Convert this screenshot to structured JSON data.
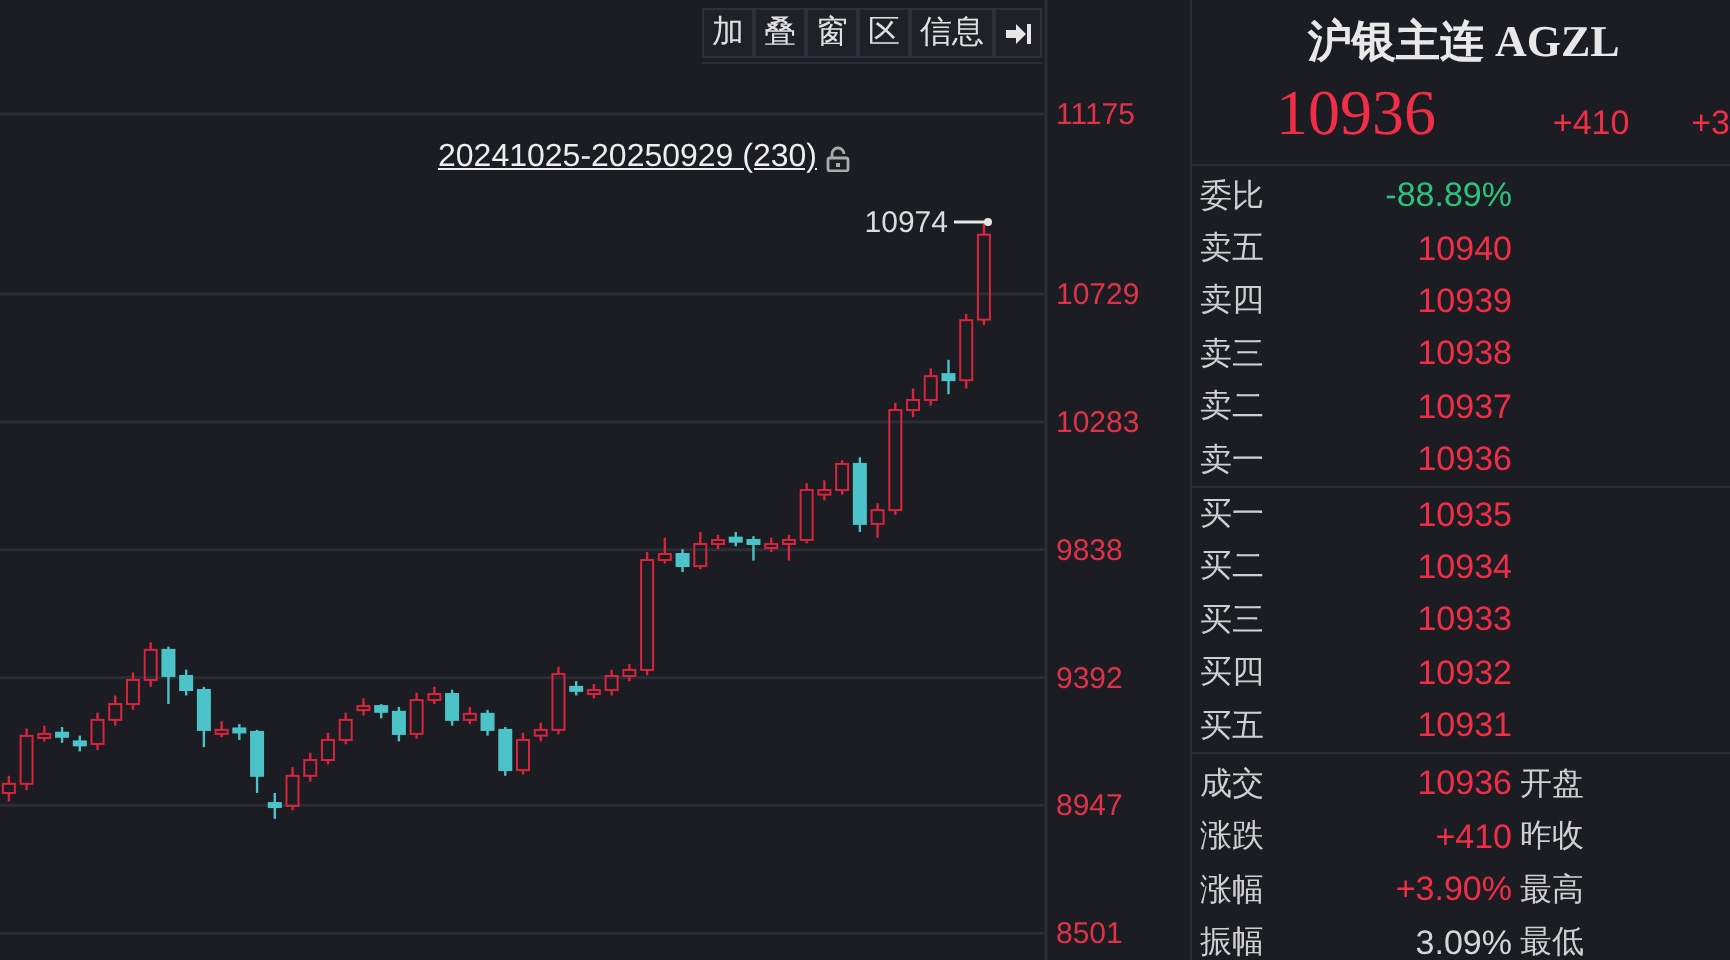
{
  "toolbar": {
    "buttons": [
      {
        "label": "加"
      },
      {
        "label": "叠"
      },
      {
        "label": "窗"
      },
      {
        "label": "区"
      },
      {
        "label": "信息"
      }
    ]
  },
  "chart": {
    "range_label": "20241025-20250929 (230)",
    "high_marker": "10974",
    "top_label": "11175",
    "chart_data": {
      "type": "candlestick",
      "ylim": [
        8408,
        11754
      ],
      "grid": true,
      "yticks": [
        10729,
        10283,
        9838,
        9392,
        8947,
        8501
      ],
      "ohlc": [
        [
          8990,
          9050,
          8960,
          9022
        ],
        [
          9022,
          9215,
          9000,
          9189
        ],
        [
          9189,
          9225,
          9170,
          9196
        ],
        [
          9200,
          9220,
          9165,
          9189
        ],
        [
          9170,
          9190,
          9135,
          9161
        ],
        [
          9161,
          9270,
          9140,
          9245
        ],
        [
          9245,
          9330,
          9225,
          9300
        ],
        [
          9300,
          9410,
          9280,
          9384
        ],
        [
          9384,
          9515,
          9360,
          9489
        ],
        [
          9489,
          9500,
          9300,
          9398
        ],
        [
          9398,
          9420,
          9330,
          9349
        ],
        [
          9349,
          9360,
          9150,
          9210
        ],
        [
          9205,
          9240,
          9185,
          9210
        ],
        [
          9215,
          9230,
          9175,
          9203
        ],
        [
          9203,
          9210,
          8990,
          9050
        ],
        [
          8955,
          8990,
          8900,
          8945
        ],
        [
          8945,
          9080,
          8930,
          9050
        ],
        [
          9050,
          9130,
          9030,
          9105
        ],
        [
          9105,
          9200,
          9090,
          9175
        ],
        [
          9175,
          9270,
          9160,
          9245
        ],
        [
          9280,
          9320,
          9260,
          9293
        ],
        [
          9293,
          9300,
          9250,
          9273
        ],
        [
          9273,
          9290,
          9170,
          9196
        ],
        [
          9196,
          9340,
          9180,
          9314
        ],
        [
          9314,
          9360,
          9300,
          9335
        ],
        [
          9335,
          9350,
          9225,
          9245
        ],
        [
          9245,
          9290,
          9230,
          9266
        ],
        [
          9266,
          9280,
          9190,
          9210
        ],
        [
          9210,
          9220,
          9050,
          9070
        ],
        [
          9070,
          9200,
          9055,
          9175
        ],
        [
          9190,
          9235,
          9170,
          9210
        ],
        [
          9210,
          9430,
          9195,
          9405
        ],
        [
          9360,
          9380,
          9330,
          9349
        ],
        [
          9340,
          9370,
          9320,
          9349
        ],
        [
          9349,
          9420,
          9330,
          9398
        ],
        [
          9398,
          9440,
          9380,
          9419
        ],
        [
          9419,
          9830,
          9400,
          9802
        ],
        [
          9802,
          9880,
          9790,
          9823
        ],
        [
          9823,
          9840,
          9760,
          9781
        ],
        [
          9781,
          9900,
          9770,
          9858
        ],
        [
          9860,
          9890,
          9840,
          9872
        ],
        [
          9880,
          9900,
          9850,
          9872
        ],
        [
          9872,
          9885,
          9800,
          9858
        ],
        [
          9850,
          9880,
          9830,
          9858
        ],
        [
          9858,
          9890,
          9800,
          9872
        ],
        [
          9872,
          10070,
          9860,
          10046
        ],
        [
          10030,
          10080,
          10010,
          10046
        ],
        [
          10046,
          10150,
          10030,
          10137
        ],
        [
          10137,
          10160,
          9900,
          9928
        ],
        [
          9928,
          10000,
          9880,
          9976
        ],
        [
          9976,
          10350,
          9960,
          10325
        ],
        [
          10325,
          10400,
          10300,
          10360
        ],
        [
          10360,
          10470,
          10340,
          10443
        ],
        [
          10450,
          10500,
          10380,
          10429
        ],
        [
          10429,
          10660,
          10400,
          10638
        ],
        [
          10640,
          10974,
          10620,
          10936
        ]
      ]
    }
  },
  "quote": {
    "title": "沪银主连 AGZL",
    "price": "10936",
    "change": "+410",
    "change_pct": "+3"
  },
  "order_book": [
    {
      "label": "委比",
      "value": "-88.89%",
      "color": "#2ec27e"
    },
    {
      "label": "卖五",
      "value": "10940",
      "color": "#f02e48"
    },
    {
      "label": "卖四",
      "value": "10939",
      "color": "#f02e48"
    },
    {
      "label": "卖三",
      "value": "10938",
      "color": "#f02e48"
    },
    {
      "label": "卖二",
      "value": "10937",
      "color": "#f02e48"
    },
    {
      "label": "卖一",
      "value": "10936",
      "color": "#f02e48"
    },
    {
      "label": "买一",
      "value": "10935",
      "color": "#f02e48"
    },
    {
      "label": "买二",
      "value": "10934",
      "color": "#f02e48"
    },
    {
      "label": "买三",
      "value": "10933",
      "color": "#f02e48"
    },
    {
      "label": "买四",
      "value": "10932",
      "color": "#f02e48"
    },
    {
      "label": "买五",
      "value": "10931",
      "color": "#f02e48"
    }
  ],
  "stats": [
    {
      "label": "成交",
      "value": "10936",
      "color": "#f02e48",
      "label_2": "开盘"
    },
    {
      "label": "涨跌",
      "value": "+410",
      "color": "#f02e48",
      "label_2": "昨收"
    },
    {
      "label": "涨幅",
      "value": "+3.90%",
      "color": "#f02e48",
      "label_2": "最高"
    },
    {
      "label": "振幅",
      "value": "3.09%",
      "color": "#d6d6d6",
      "label_2": "最低"
    }
  ]
}
